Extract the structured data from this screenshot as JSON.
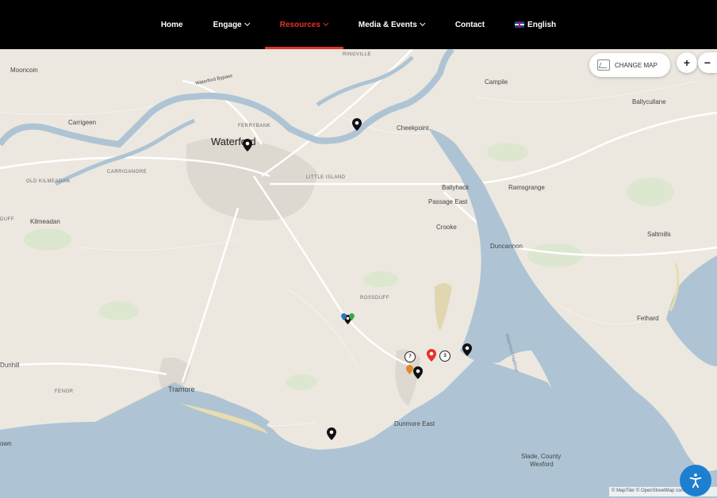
{
  "nav": {
    "items": [
      {
        "label": "Home",
        "dropdown": false,
        "active": false
      },
      {
        "label": "Engage",
        "dropdown": true,
        "active": false
      },
      {
        "label": "Resources",
        "dropdown": true,
        "active": true
      },
      {
        "label": "Media & Events",
        "dropdown": true,
        "active": false
      },
      {
        "label": "Contact",
        "dropdown": false,
        "active": false
      }
    ],
    "language": "English"
  },
  "colors": {
    "accent": "#e5322b",
    "nav_bg": "#000000",
    "water": "#aec4d4",
    "land": "#ece8e0",
    "accessibility": "#1e7fd1"
  },
  "map": {
    "change_map_label": "CHANGE MAP",
    "zoom_in": "+",
    "zoom_out": "−",
    "attribution": "© MapTiler © OpenStreetMap contributors",
    "places": {
      "waterford": "Waterford",
      "mooncoin": "Mooncoin",
      "carrigeen": "Carrigeen",
      "carriganore": "CARRIGANORE",
      "old_kilmeadan": "OLD KILMEADAN",
      "kilmeadan": "Kilmeadan",
      "ferrybank": "FERRYBANK",
      "ringville": "RINGVILLE",
      "waterford_bypass": "Waterford Bypass",
      "cheekpoint": "Cheekpoint",
      "little_island": "LITTLE ISLAND",
      "campile": "Campile",
      "ballycullane": "Ballycullane",
      "ballyhack": "Ballyhack",
      "passage_east": "Passage East",
      "ramsgrange": "Ramsgrange",
      "crooke": "Crooke",
      "duncannon": "Duncannon",
      "saltmills": "Saltmills",
      "rossduff": "ROSSDUFF",
      "fethard": "Fethard",
      "dunhill": "Dunhill",
      "fenor": "FENOR",
      "tramore": "Tramore",
      "dunmore_east": "Dunmore East",
      "slade": "Slade, County",
      "wexford": "Wexford",
      "duff": "DUFF",
      "town": "own",
      "waterford_harbour": "Waterford Harbour"
    },
    "clusters": [
      "7",
      "3"
    ]
  },
  "accessibility_label": "Accessibility"
}
